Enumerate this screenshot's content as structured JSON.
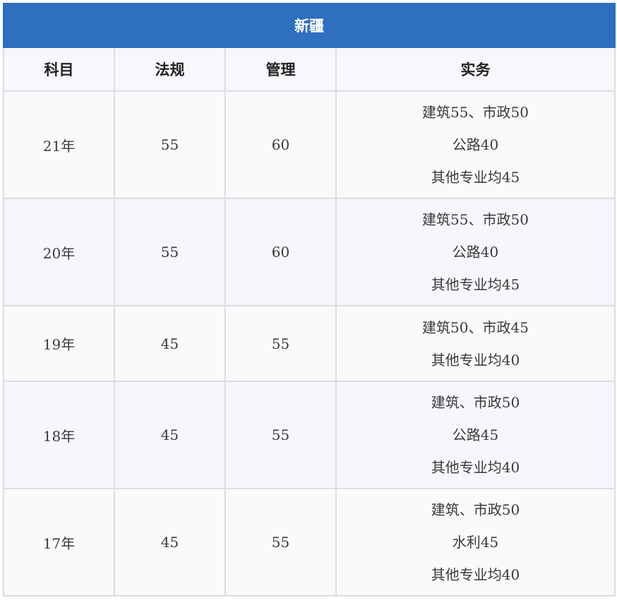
{
  "table": {
    "title": "新疆",
    "headers": [
      "科目",
      "法规",
      "管理",
      "实务"
    ],
    "rows": [
      {
        "year": "21年",
        "law": "55",
        "management": "60",
        "practice": [
          "建筑55、市政50",
          "公路40",
          "其他专业均45"
        ]
      },
      {
        "year": "20年",
        "law": "55",
        "management": "60",
        "practice": [
          "建筑55、市政50",
          "公路40",
          "其他专业均45"
        ]
      },
      {
        "year": "19年",
        "law": "45",
        "management": "55",
        "practice": [
          "建筑50、市政45",
          "其他专业均40"
        ]
      },
      {
        "year": "18年",
        "law": "45",
        "management": "55",
        "practice": [
          "建筑、市政50",
          "公路45",
          "其他专业均40"
        ]
      },
      {
        "year": "17年",
        "law": "45",
        "management": "55",
        "practice": [
          "建筑、市政50",
          "水利45",
          "其他专业均40"
        ]
      }
    ]
  },
  "colors": {
    "title_background": "#2f6fbf",
    "title_text": "#ffffff",
    "border": "#dcdce4",
    "row_odd": "#fafafa",
    "row_even": "#f6f7fc"
  }
}
